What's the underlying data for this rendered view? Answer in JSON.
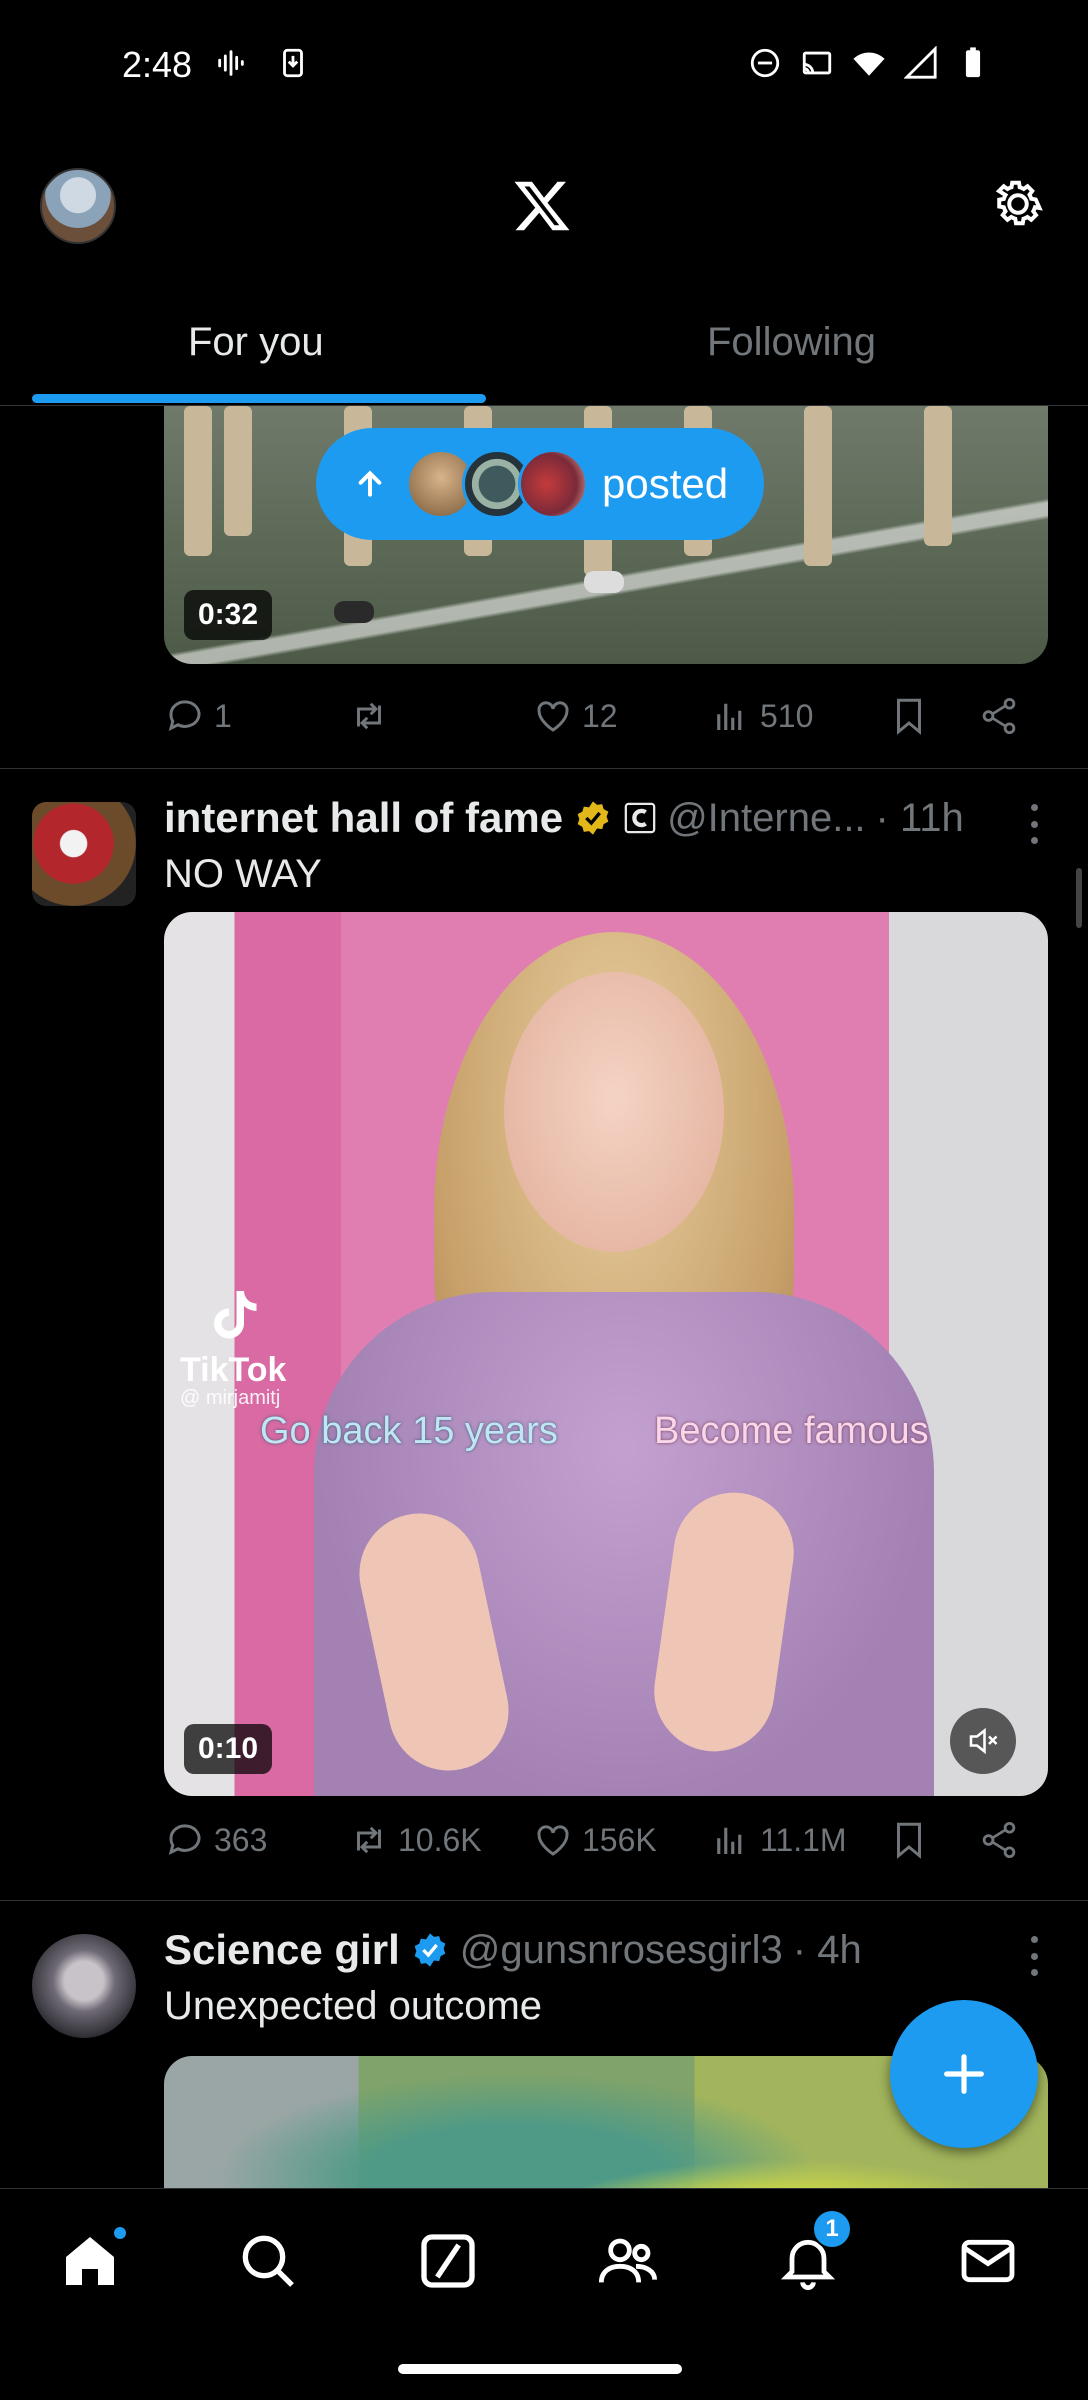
{
  "status_bar": {
    "time": "2:48"
  },
  "tabs": [
    {
      "label": "For you",
      "active": true
    },
    {
      "label": "Following",
      "active": false
    }
  ],
  "new_posts_pill": {
    "label": "posted"
  },
  "colors": {
    "accent": "#1d9bf0",
    "background": "#000000",
    "muted_text": "#71767b"
  },
  "posts": [
    {
      "media_duration": "0:32",
      "stats": {
        "replies": "1",
        "reposts": "",
        "likes": "12",
        "views": "510"
      }
    },
    {
      "author": "internet hall of fame",
      "handle": "@Interne...",
      "time": "· 11h",
      "text": "NO WAY",
      "media": {
        "duration": "0:10",
        "watermark_name": "TikTok",
        "watermark_handle": "@ mirjamitj",
        "caption_left": "Go back 15 years",
        "caption_right": "Become famous"
      },
      "stats": {
        "replies": "363",
        "reposts": "10.6K",
        "likes": "156K",
        "views": "11.1M"
      }
    },
    {
      "author": "Science girl",
      "handle": "@gunsnrosesgirl3",
      "time": "· 4h",
      "text": "Unexpected outcome"
    }
  ],
  "bottom_nav": {
    "items": [
      "home",
      "search",
      "grok",
      "communities",
      "notifications",
      "messages"
    ],
    "notification_count": "1"
  }
}
